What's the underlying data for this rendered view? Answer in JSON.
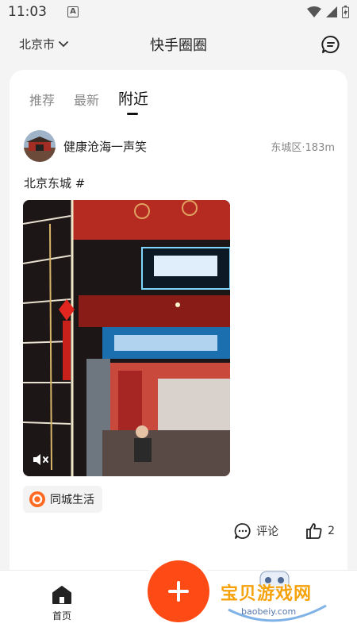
{
  "status_bar": {
    "time": "11:03",
    "notification_letter": "A"
  },
  "header": {
    "city": "北京市",
    "title": "快手圈圈"
  },
  "tabs": [
    {
      "label": "推荐",
      "active": false
    },
    {
      "label": "最新",
      "active": false
    },
    {
      "label": "附近",
      "active": true
    }
  ],
  "post": {
    "author": "健康沧海一声笑",
    "location": "东城区·183m",
    "text": "北京东城 #",
    "topic_tag": "同城生活",
    "comment_label": "评论",
    "like_count": "2"
  },
  "bottom_nav": {
    "home_label": "首页"
  },
  "watermark": {
    "text": "宝贝游戏网",
    "url": "baobeiy.com"
  },
  "colors": {
    "accent": "#fe4a15",
    "background": "#f4f4f4"
  }
}
